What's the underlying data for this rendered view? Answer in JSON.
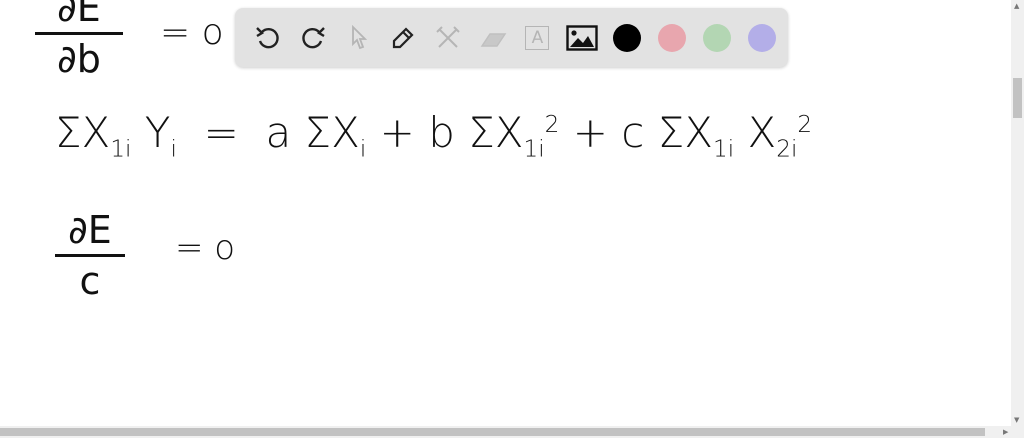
{
  "toolbar": {
    "tools": [
      {
        "name": "undo-icon",
        "enabled": true
      },
      {
        "name": "redo-icon",
        "enabled": true
      },
      {
        "name": "select-pointer-icon",
        "enabled": false
      },
      {
        "name": "pen-icon",
        "enabled": true
      },
      {
        "name": "tools-icon",
        "enabled": false
      },
      {
        "name": "eraser-icon",
        "enabled": false
      },
      {
        "name": "text-box-icon",
        "enabled": false,
        "label": "A"
      },
      {
        "name": "image-icon",
        "enabled": true
      }
    ],
    "colors": [
      "#000000",
      "#e8a6ae",
      "#b3d6b3",
      "#b3aee8"
    ]
  },
  "board": {
    "line1": {
      "numerator": "∂E",
      "denominator": "∂b",
      "rhs": "= o"
    },
    "line2": {
      "lhs": "ΣX",
      "lhs_sub": "1i",
      "lhs_y": "Y",
      "lhs_y_sub": "i",
      "eq": "=",
      "t1": "a ΣX",
      "t1_sub": "i",
      "plus1": "+",
      "t2": "b ΣX",
      "t2_sub": "1i",
      "t2_sup": "2",
      "plus2": "+",
      "t3": "c ΣX",
      "t3_sub": "1i",
      "t3_x": "X",
      "t3_x_sub": "2i",
      "t3_x_sup": "2"
    },
    "line3": {
      "numerator": "∂E",
      "denominator": "c",
      "rhs": "= o"
    }
  }
}
